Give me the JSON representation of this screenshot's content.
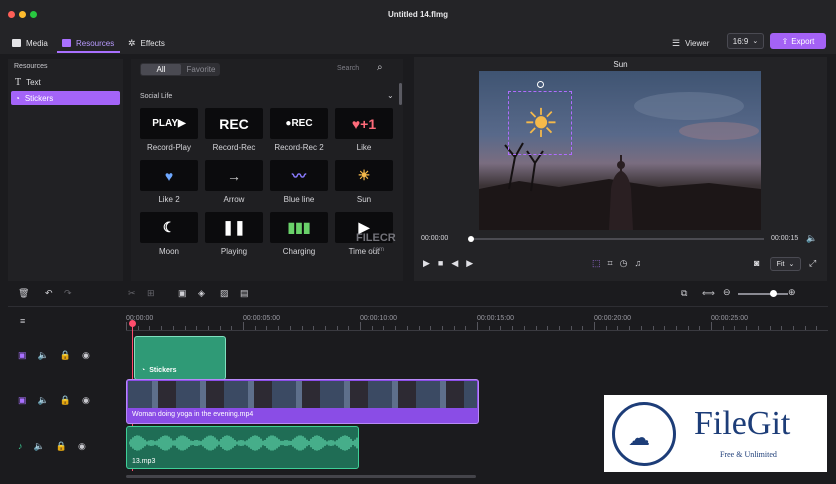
{
  "window": {
    "title": "Untitled 14.flmg"
  },
  "toolbar": {
    "tabs": [
      {
        "label": "Media"
      },
      {
        "label": "Resources"
      },
      {
        "label": "Effects"
      }
    ],
    "viewer_label": "Viewer",
    "aspect_value": "16:9",
    "export_label": "Export"
  },
  "sidebar": {
    "heading": "Resources",
    "items": [
      {
        "label": "Text"
      },
      {
        "label": "Stickers"
      }
    ]
  },
  "library": {
    "filters": [
      "All",
      "Favorite"
    ],
    "search_placeholder": "Search",
    "category": "Social Life",
    "stickers": [
      {
        "label": "Record-Play",
        "art": "PLAY▶"
      },
      {
        "label": "Record-Rec",
        "art": "REC"
      },
      {
        "label": "Record-Rec 2",
        "art": "●REC"
      },
      {
        "label": "Like",
        "art": "♥+1"
      },
      {
        "label": "Like 2",
        "art": "♥"
      },
      {
        "label": "Arrow",
        "art": "→"
      },
      {
        "label": "Blue line",
        "art": "〰"
      },
      {
        "label": "Sun",
        "art": "☀"
      },
      {
        "label": "Moon",
        "art": "☾"
      },
      {
        "label": "Playing",
        "art": "❚❚"
      },
      {
        "label": "Charging",
        "art": "▮▮▮"
      },
      {
        "label": "Time out",
        "art": "▶"
      }
    ]
  },
  "viewer": {
    "clip_title": "Sun",
    "current_time": "00:00:00",
    "total_time": "00:00:15",
    "fit_label": "Fit",
    "progress": 0.0
  },
  "timeline": {
    "ruler_ticks": [
      "00:00:00",
      "00:00:05:00",
      "00:00:10:00",
      "00:00:15:00",
      "00:00:20:00",
      "00:00:25:00"
    ],
    "clips": {
      "stickers": "Stickers",
      "video": "Woman doing yoga in the evening.mp4",
      "audio": "13.mp3"
    }
  },
  "overlays": {
    "filecr": "FILECR",
    "filecr_sub": ".com",
    "filegit": "FileGit",
    "filegit_sub": "Free & Unlimited"
  },
  "colors": {
    "accent": "#a970ff",
    "sticker_clip": "#2f9a76",
    "audio_clip": "#2fa37d",
    "video_clip": "#8a4de6"
  }
}
